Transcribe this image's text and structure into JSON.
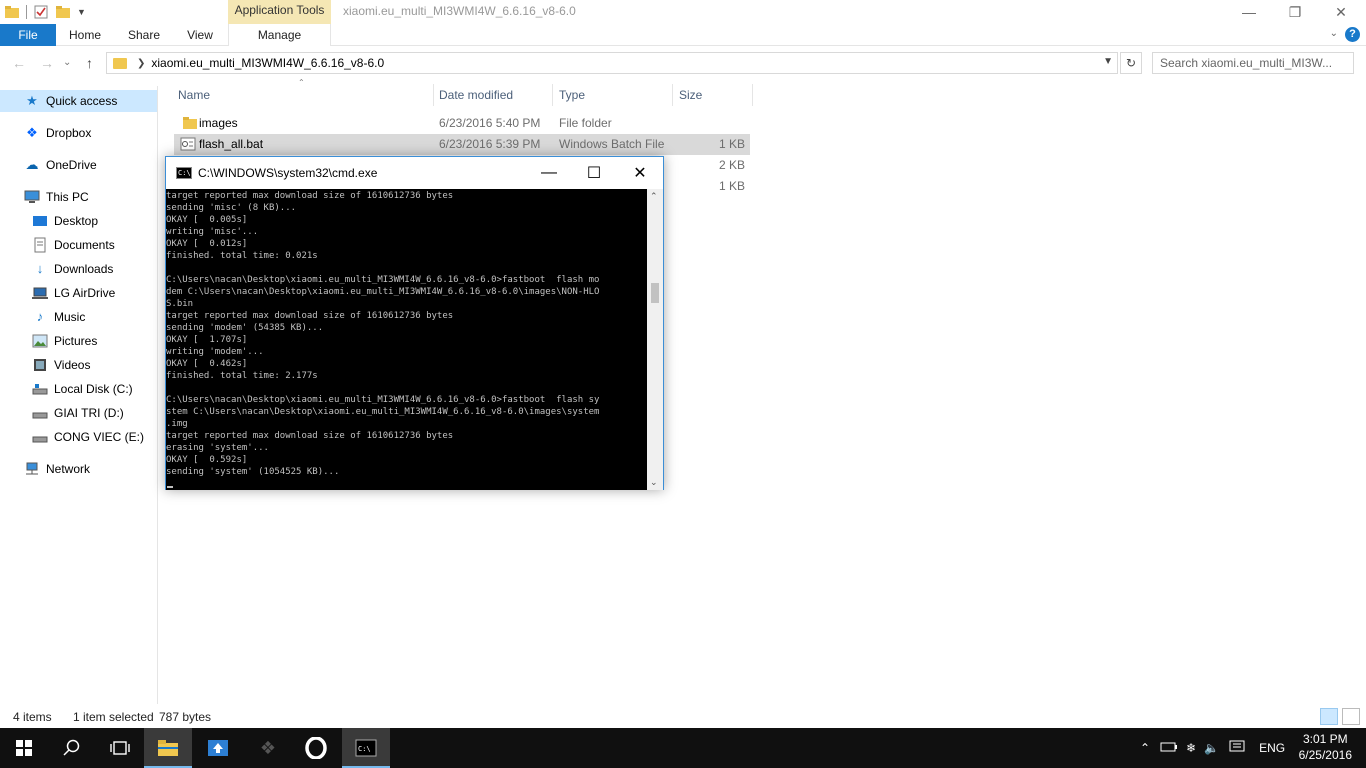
{
  "window": {
    "title": "xiaomi.eu_multi_MI3WMI4W_6.6.16_v8-6.0",
    "context_tab": "Application Tools"
  },
  "ribbon": {
    "tabs": [
      "File",
      "Home",
      "Share",
      "View",
      "Manage"
    ]
  },
  "address": {
    "path": "xiaomi.eu_multi_MI3WMI4W_6.6.16_v8-6.0",
    "search_placeholder": "Search xiaomi.eu_multi_MI3W..."
  },
  "nav": {
    "items": [
      {
        "label": "Quick access",
        "icon": "star-icon"
      },
      {
        "label": "Dropbox",
        "icon": "dropbox-icon"
      },
      {
        "label": "OneDrive",
        "icon": "cloud-icon"
      },
      {
        "label": "This PC",
        "icon": "computer-icon"
      },
      {
        "label": "Desktop",
        "icon": "desktop-icon"
      },
      {
        "label": "Documents",
        "icon": "documents-icon"
      },
      {
        "label": "Downloads",
        "icon": "download-icon"
      },
      {
        "label": "LG AirDrive",
        "icon": "drive-icon"
      },
      {
        "label": "Music",
        "icon": "music-icon"
      },
      {
        "label": "Pictures",
        "icon": "pictures-icon"
      },
      {
        "label": "Videos",
        "icon": "videos-icon"
      },
      {
        "label": "Local Disk (C:)",
        "icon": "disk-icon"
      },
      {
        "label": "GIAI TRI (D:)",
        "icon": "disk-icon"
      },
      {
        "label": "CONG VIEC (E:)",
        "icon": "disk-icon"
      },
      {
        "label": "Network",
        "icon": "network-icon"
      }
    ]
  },
  "columns": {
    "name": "Name",
    "date": "Date modified",
    "type": "Type",
    "size": "Size"
  },
  "files": [
    {
      "name": "images",
      "date": "6/23/2016 5:40 PM",
      "type": "File folder",
      "size": ""
    },
    {
      "name": "flash_all.bat",
      "date": "6/23/2016 5:39 PM",
      "type": "Windows Batch File",
      "size": "1 KB"
    },
    {
      "name": "",
      "date": "",
      "type": "",
      "size": "2 KB"
    },
    {
      "name": "",
      "date": "",
      "type": "",
      "size": "1 KB"
    }
  ],
  "status": {
    "items": "4 items",
    "selected": "1 item selected",
    "size": "787 bytes"
  },
  "cmd": {
    "title": "C:\\WINDOWS\\system32\\cmd.exe",
    "lines": [
      "target reported max download size of 1610612736 bytes",
      "sending 'misc' (8 KB)...",
      "OKAY [  0.005s]",
      "writing 'misc'...",
      "OKAY [  0.012s]",
      "finished. total time: 0.021s",
      "",
      "C:\\Users\\nacan\\Desktop\\xiaomi.eu_multi_MI3WMI4W_6.6.16_v8-6.0>fastboot  flash mo",
      "dem C:\\Users\\nacan\\Desktop\\xiaomi.eu_multi_MI3WMI4W_6.6.16_v8-6.0\\images\\NON-HLO",
      "S.bin",
      "target reported max download size of 1610612736 bytes",
      "sending 'modem' (54385 KB)...",
      "OKAY [  1.707s]",
      "writing 'modem'...",
      "OKAY [  0.462s]",
      "finished. total time: 2.177s",
      "",
      "C:\\Users\\nacan\\Desktop\\xiaomi.eu_multi_MI3WMI4W_6.6.16_v8-6.0>fastboot  flash sy",
      "stem C:\\Users\\nacan\\Desktop\\xiaomi.eu_multi_MI3WMI4W_6.6.16_v8-6.0\\images\\system",
      ".img",
      "target reported max download size of 1610612736 bytes",
      "erasing 'system'...",
      "OKAY [  0.592s]",
      "sending 'system' (1054525 KB)..."
    ]
  },
  "taskbar": {
    "language": "ENG",
    "time": "3:01 PM",
    "date": "6/25/2016"
  },
  "colors": {
    "accent": "#1979ca",
    "selection": "#cce8ff",
    "context_tab": "#f5e7b4",
    "taskbar": "#101010"
  }
}
